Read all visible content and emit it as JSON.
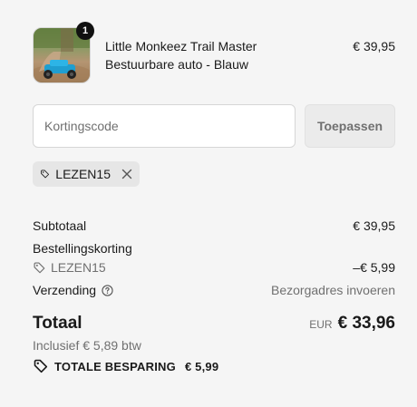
{
  "product": {
    "title": "Little Monkeez Trail Master Bestuurbare auto - Blauw",
    "price": "€ 39,95",
    "quantity": "1",
    "image_icon": "rc-car-photo"
  },
  "discount": {
    "placeholder": "Kortingscode",
    "apply_label": "Toepassen",
    "applied_code": "LEZEN15"
  },
  "summary": {
    "subtotal_label": "Subtotaal",
    "subtotal_value": "€ 39,95",
    "order_discount_label": "Bestellingskorting",
    "order_discount_code": "LEZEN15",
    "order_discount_value": "–€ 5,99",
    "shipping_label": "Verzending",
    "shipping_value": "Bezorgadres invoeren",
    "total_label": "Totaal",
    "currency": "EUR",
    "total_value": "€ 33,96",
    "tax_note": "Inclusief € 5,89 btw",
    "savings_label": "TOTALE BESPARING",
    "savings_value": "€ 5,99"
  },
  "colors": {
    "background": "#f5f5f5",
    "text": "#1a1a1a",
    "muted": "#707070",
    "badge": "#111111"
  }
}
